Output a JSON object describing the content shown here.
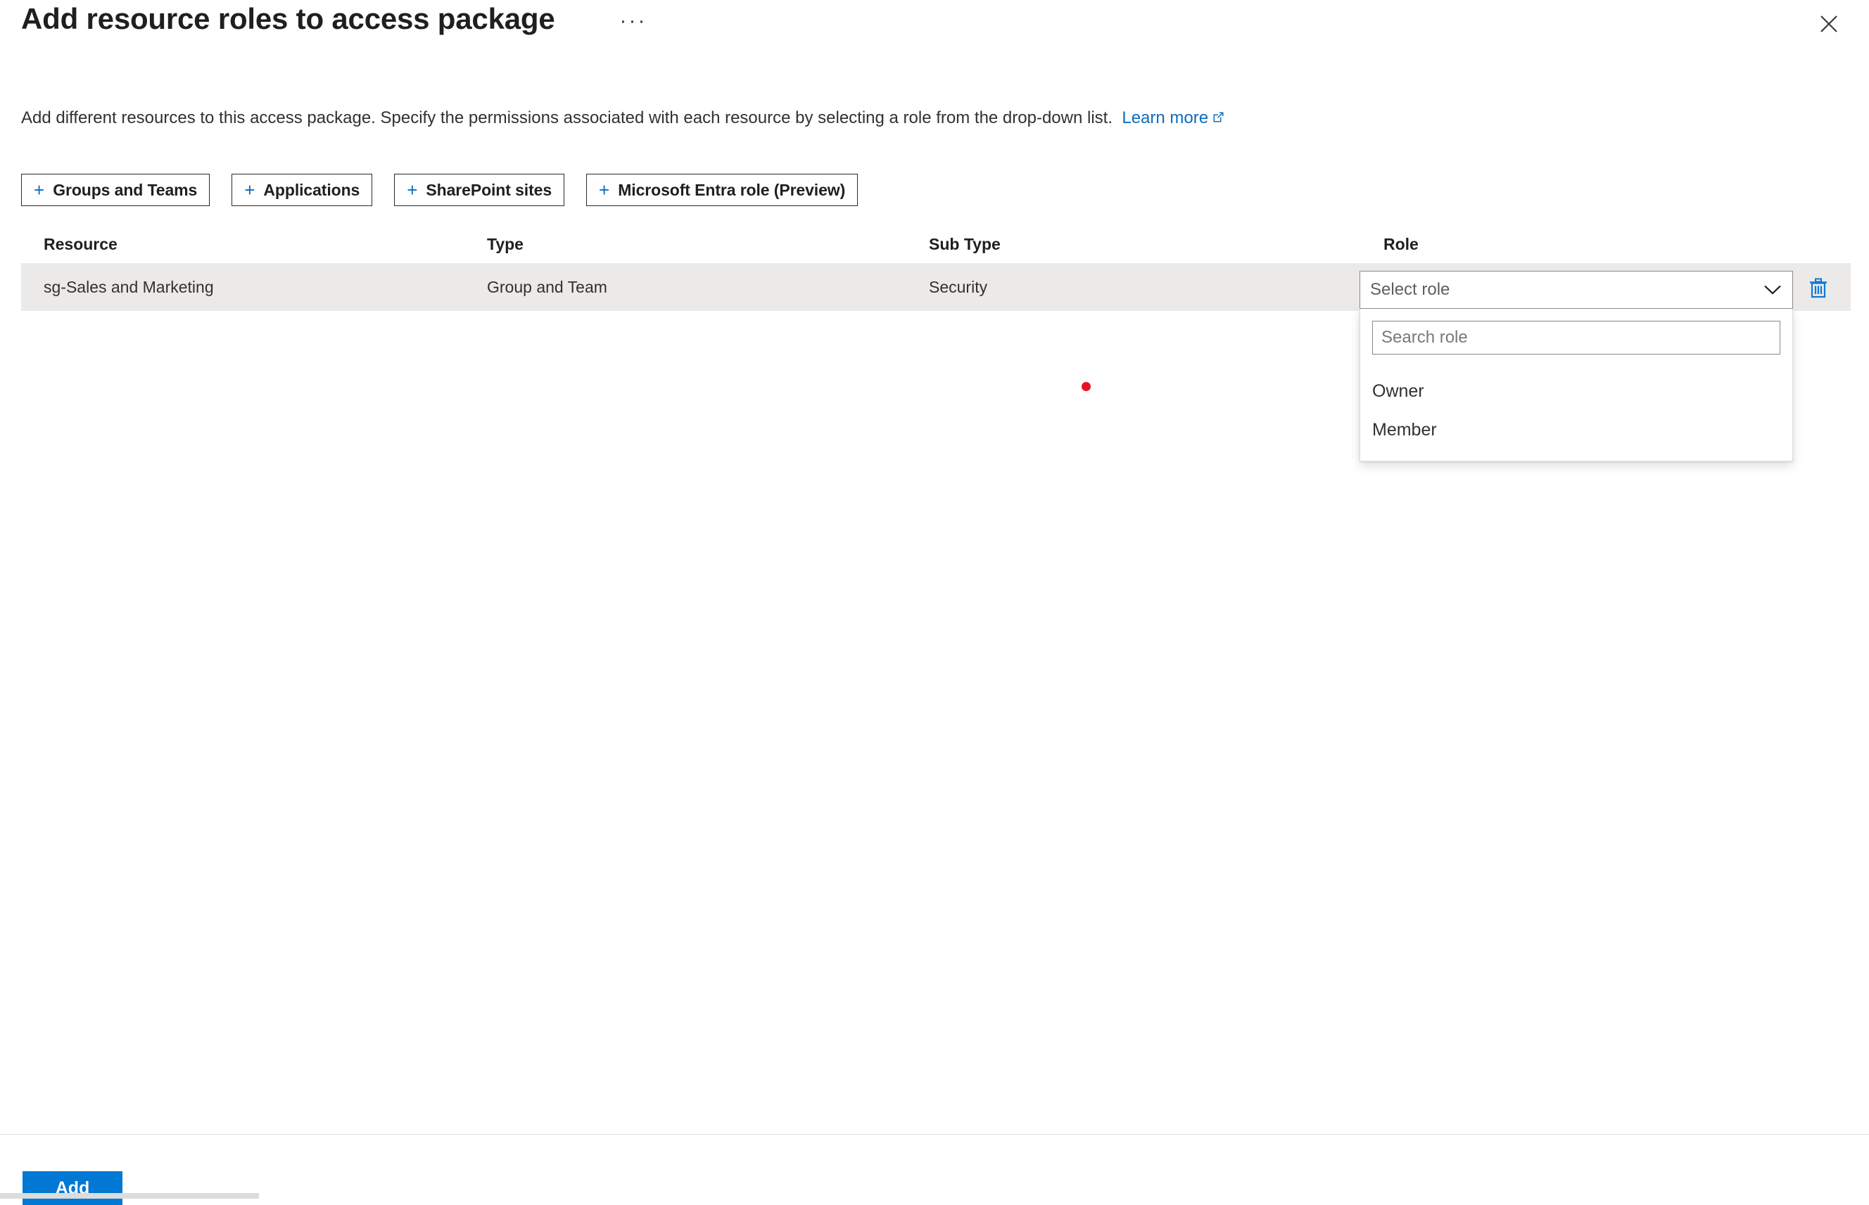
{
  "header": {
    "title": "Add resource roles to access package",
    "more_icon": "ellipsis-icon",
    "more_label": "···",
    "close_icon": "close-icon"
  },
  "description": {
    "text": "Add different resources to this access package. Specify the permissions associated with each resource by selecting a role from the drop-down list.",
    "link_label": "Learn more",
    "link_icon": "external-link-icon"
  },
  "command_bar": {
    "plus": "+",
    "buttons": [
      {
        "label": "Groups and Teams",
        "icon": "plus-icon"
      },
      {
        "label": "Applications",
        "icon": "plus-icon"
      },
      {
        "label": "SharePoint sites",
        "icon": "plus-icon"
      },
      {
        "label": "Microsoft Entra role (Preview)",
        "icon": "plus-icon"
      }
    ]
  },
  "table": {
    "columns": {
      "resource": "Resource",
      "type": "Type",
      "sub_type": "Sub Type",
      "role": "Role"
    },
    "rows": [
      {
        "resource": "sg-Sales and Marketing",
        "type": "Group and Team",
        "sub_type": "Security",
        "role_value": "Select role",
        "delete_icon": "trash-icon"
      }
    ]
  },
  "role_dropdown": {
    "selected_label": "Select role",
    "chevron_icon": "chevron-down-icon",
    "search_placeholder": "Search role",
    "search_value": "",
    "options": [
      {
        "label": "Owner"
      },
      {
        "label": "Member"
      }
    ]
  },
  "footer": {
    "add_label": "Add"
  },
  "colors": {
    "accent": "#0078d4",
    "link": "#0f6cbd",
    "row_selected": "#ebeae9",
    "cursor_marker": "#e81123",
    "border": "#8a8886",
    "text": "#323130"
  }
}
